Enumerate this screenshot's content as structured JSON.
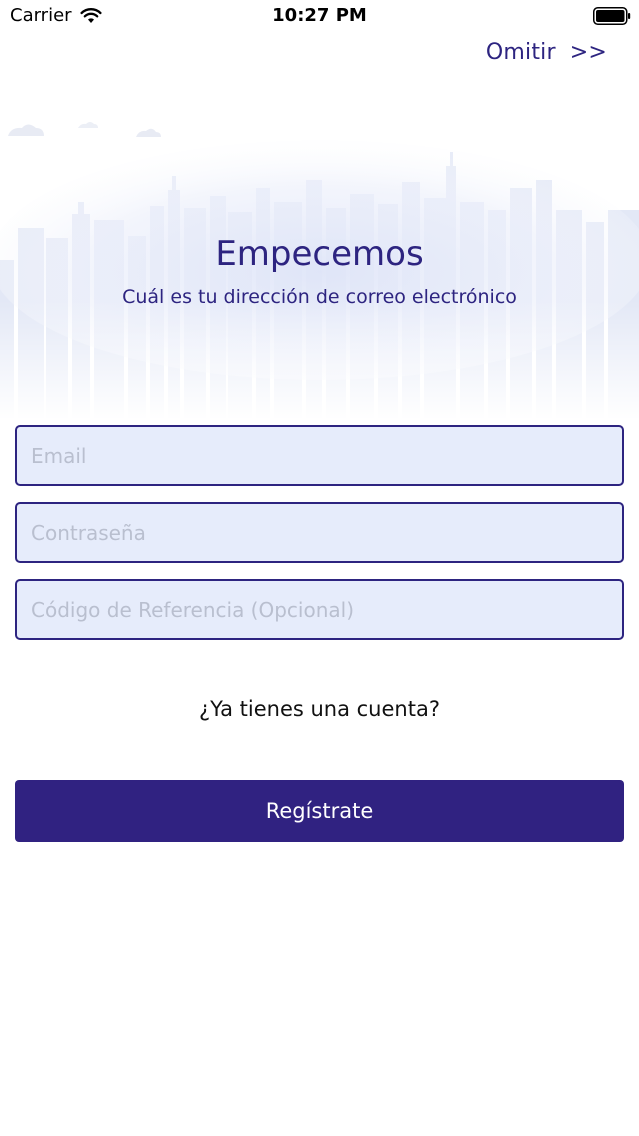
{
  "status_bar": {
    "carrier": "Carrier",
    "time": "10:27 PM"
  },
  "header": {
    "skip_label": "Omitir",
    "skip_arrows": ">>"
  },
  "intro": {
    "title": "Empecemos",
    "subtitle": "Cuál es tu dirección de correo electrónico"
  },
  "form": {
    "email_placeholder": "Email",
    "email_value": "",
    "password_placeholder": "Contraseña",
    "password_value": "",
    "referral_placeholder": "Código de Referencia (Opcional)",
    "referral_value": ""
  },
  "login_link": "¿Ya tienes una cuenta?",
  "register_button": "Regístrate",
  "colors": {
    "primary": "#302281",
    "field_background": "#e6ecfb",
    "skyline": "#e3e8f7"
  },
  "icons": {
    "wifi": "wifi-icon",
    "battery": "battery-icon",
    "skyline": "city-skyline-illustration"
  }
}
